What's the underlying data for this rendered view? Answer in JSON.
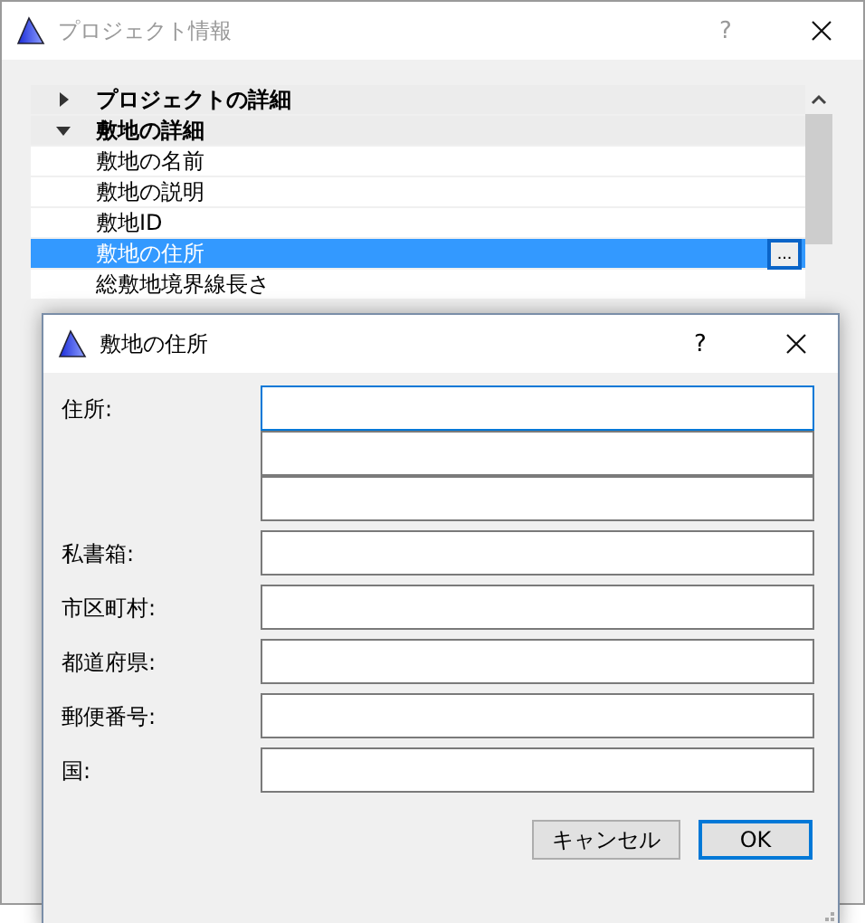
{
  "window": {
    "title": "プロジェクト情報",
    "help": "?"
  },
  "tree": [
    {
      "label": "プロジェクトの詳細",
      "expanded": false
    },
    {
      "label": "敷地の詳細",
      "expanded": true,
      "children": [
        {
          "label": "敷地の名前",
          "selected": false
        },
        {
          "label": "敷地の説明",
          "selected": false
        },
        {
          "label": "敷地ID",
          "selected": false
        },
        {
          "label": "敷地の住所",
          "selected": true,
          "action": "..."
        },
        {
          "label": "総敷地境界線長さ",
          "selected": false
        }
      ]
    }
  ],
  "dialog": {
    "title": "敷地の住所",
    "help": "?",
    "fields": [
      {
        "label": "住所:",
        "inputs": [
          {
            "focused": true
          },
          {
            "focused": false
          },
          {
            "focused": false
          }
        ]
      },
      {
        "label": "私書箱:",
        "inputs": [
          {
            "focused": false
          }
        ]
      },
      {
        "label": "市区町村:",
        "inputs": [
          {
            "focused": false
          }
        ]
      },
      {
        "label": "都道府県:",
        "inputs": [
          {
            "focused": false
          }
        ]
      },
      {
        "label": "郵便番号:",
        "inputs": [
          {
            "focused": false
          }
        ]
      },
      {
        "label": "国:",
        "inputs": [
          {
            "focused": false
          }
        ]
      }
    ],
    "buttons": [
      {
        "label": "キャンセル",
        "default": false
      },
      {
        "label": "OK",
        "default": true
      }
    ]
  }
}
